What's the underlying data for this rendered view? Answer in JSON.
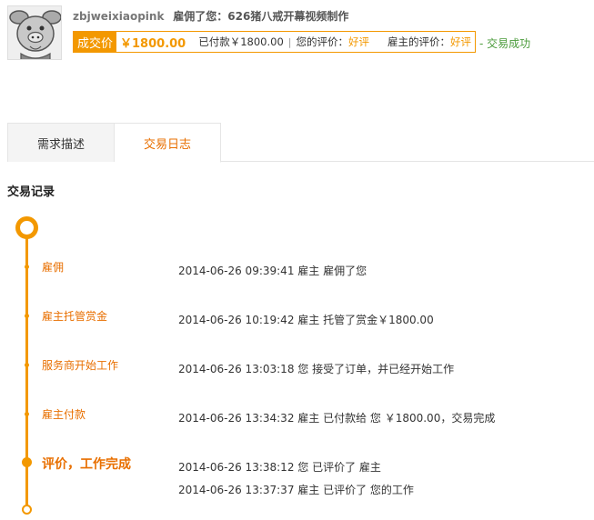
{
  "header": {
    "username": "zbjweixiaopink",
    "title": "雇佣了您：626猪八戒开幕视频制作"
  },
  "deal": {
    "label": "成交价",
    "price": "￥1800.00",
    "paid": "已付款￥1800.00",
    "sep": "|",
    "your_rating_label": "您的评价：",
    "your_rating": "好评",
    "employer_rating_label": "雇主的评价：",
    "employer_rating": "好评",
    "status": "- 交易成功"
  },
  "tabs": [
    {
      "label": "需求描述"
    },
    {
      "label": "交易日志"
    }
  ],
  "section_title": "交易记录",
  "timeline": [
    {
      "label": "雇佣",
      "text": "2014-06-26 09:39:41 雇主 雇佣了您"
    },
    {
      "label": "雇主托管赏金",
      "text": "2014-06-26 10:19:42 雇主 托管了赏金￥1800.00"
    },
    {
      "label": "服务商开始工作",
      "text": "2014-06-26 13:03:18 您 接受了订单，并已经开始工作"
    },
    {
      "label": "雇主付款",
      "text": "2014-06-26 13:34:32 雇主 已付款给 您 ￥1800.00，交易完成"
    },
    {
      "label": "评价，工作完成",
      "text": "2014-06-26 13:38:12 您  已评价了 雇主",
      "text2": "2014-06-26 13:37:37 雇主  已评价了 您的工作"
    }
  ],
  "colors": {
    "accent": "#f39800",
    "label": "#e86f00",
    "success": "#4a9b3a"
  }
}
